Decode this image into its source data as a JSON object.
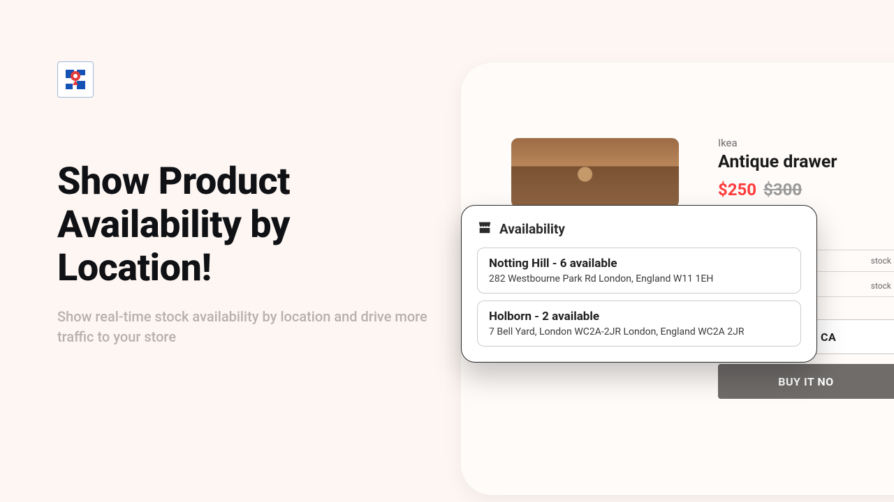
{
  "hero": {
    "title": "Show Product Availability by Location!",
    "subtitle": "Show real-time stock availability by location and drive more traffic to your store"
  },
  "product": {
    "brand": "Ikea",
    "title": "Antique drawer",
    "price_sale": "$250",
    "price_original": "$300",
    "stock_badge_1": "stock",
    "stock_badge_2": "stock",
    "add_to_cart_label": "ADD TO CA",
    "buy_now_label": "BUY IT NO"
  },
  "availability": {
    "title": "Availability",
    "locations": [
      {
        "name": "Notting Hill - 6 available",
        "address": "282 Westbourne Park Rd London, England W11 1EH"
      },
      {
        "name": "Holborn - 2 available",
        "address": "7 Bell Yard, London WC2A-2JR London, England WC2A 2JR"
      }
    ]
  }
}
